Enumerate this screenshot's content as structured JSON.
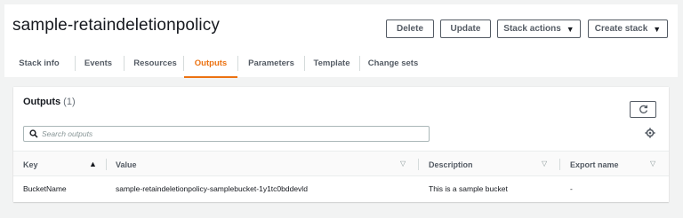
{
  "header": {
    "title": "sample-retaindeletionpolicy",
    "buttons": {
      "delete": "Delete",
      "update": "Update",
      "stack_actions": "Stack actions",
      "create_stack": "Create stack"
    }
  },
  "tabs": [
    {
      "label": "Stack info",
      "active": false
    },
    {
      "label": "Events",
      "active": false
    },
    {
      "label": "Resources",
      "active": false
    },
    {
      "label": "Outputs",
      "active": true
    },
    {
      "label": "Parameters",
      "active": false
    },
    {
      "label": "Template",
      "active": false
    },
    {
      "label": "Change sets",
      "active": false
    }
  ],
  "outputs": {
    "title": "Outputs",
    "count": "(1)",
    "search_placeholder": "Search outputs",
    "search_value": "",
    "columns": [
      "Key",
      "Value",
      "Description",
      "Export name"
    ],
    "sorted_column": "Key",
    "rows": [
      {
        "key": "BucketName",
        "value": "sample-retaindeletionpolicy-samplebucket-1y1tc0bddevld",
        "description": "This is a sample bucket",
        "export_name": "-"
      }
    ]
  },
  "icons": {
    "refresh": "refresh-icon",
    "search": "search-icon",
    "settings": "settings-icon",
    "sort_up": "sort-ascending-icon",
    "sort_down": "sort-icon",
    "caret": "caret-down-icon"
  },
  "colors": {
    "accent": "#ec7211",
    "background": "#f2f3f3",
    "text": "#16191f",
    "muted": "#545b64"
  }
}
